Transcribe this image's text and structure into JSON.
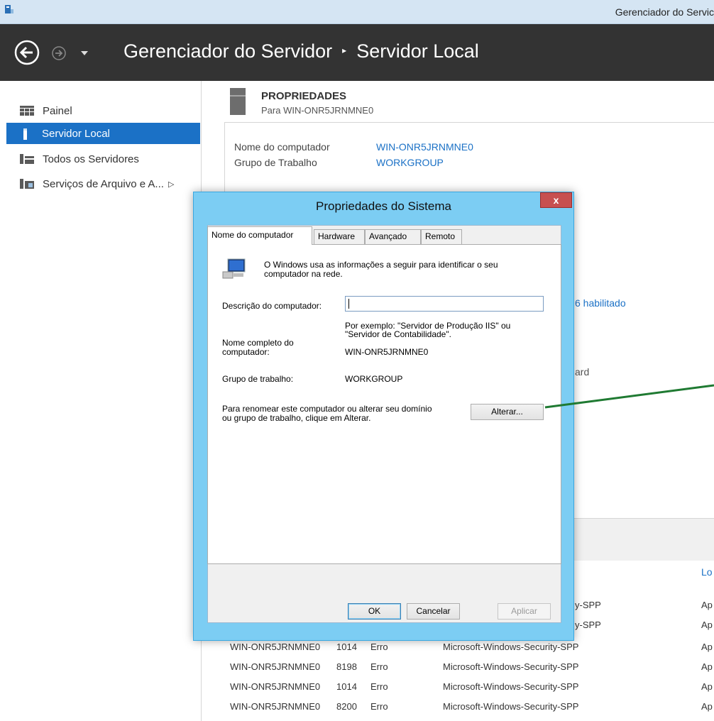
{
  "window": {
    "title": "Gerenciador do Servic"
  },
  "header": {
    "crumb_root": "Gerenciador do Servidor",
    "crumb_sep": "▸",
    "crumb_current": "Servidor Local"
  },
  "sidebar": {
    "items": [
      {
        "label": "Painel",
        "icon": "dashboard-icon"
      },
      {
        "label": "Servidor Local",
        "icon": "server-icon",
        "active": true
      },
      {
        "label": "Todos os Servidores",
        "icon": "servers-icon"
      },
      {
        "label": "Serviços de Arquivo e A...",
        "icon": "file-services-icon",
        "expand": "▷"
      }
    ]
  },
  "properties": {
    "title": "PROPRIEDADES",
    "subtitle": "Para WIN-ONR5JRNMNE0",
    "rows": [
      {
        "label": "Nome do computador",
        "value": "WIN-ONR5JRNMNE0"
      },
      {
        "label": "Grupo de Trabalho",
        "value": "WORKGROUP"
      }
    ],
    "peek_ipv6": "6 habilitado",
    "peek_ard": "ard"
  },
  "events": {
    "col_header": "Lo",
    "rows": [
      {
        "server": "",
        "id": "",
        "level": "",
        "source": "y-SPP",
        "log": "Ap"
      },
      {
        "server": "",
        "id": "",
        "level": "",
        "source": "y-SPP",
        "log": "Ap"
      },
      {
        "server": "WIN-ONR5JRNMNE0",
        "id": "1014",
        "level": "Erro",
        "source": "Microsoft-Windows-Security-SPP",
        "log": "Ap"
      },
      {
        "server": "WIN-ONR5JRNMNE0",
        "id": "8198",
        "level": "Erro",
        "source": "Microsoft-Windows-Security-SPP",
        "log": "Ap"
      },
      {
        "server": "WIN-ONR5JRNMNE0",
        "id": "1014",
        "level": "Erro",
        "source": "Microsoft-Windows-Security-SPP",
        "log": "Ap"
      },
      {
        "server": "WIN-ONR5JRNMNE0",
        "id": "8200",
        "level": "Erro",
        "source": "Microsoft-Windows-Security-SPP",
        "log": "Ap"
      }
    ]
  },
  "dialog": {
    "title": "Propriedades do Sistema",
    "close": "x",
    "tabs": [
      "Nome do computador",
      "Hardware",
      "Avançado",
      "Remoto"
    ],
    "intro_line1": "O Windows usa as informações a seguir para identificar o seu",
    "intro_line2": "computador na rede.",
    "desc_label": "Descrição do computador:",
    "desc_value": "",
    "example_line1": "Por exemplo: \"Servidor de Produção IIS\" ou",
    "example_line2": "\"Servidor de Contabilidade\".",
    "fullname_label_1": "Nome completo do",
    "fullname_label_2": "computador:",
    "fullname_value": "WIN-ONR5JRNMNE0",
    "workgroup_label": "Grupo de trabalho:",
    "workgroup_value": "WORKGROUP",
    "rename_line1": "Para renomear este computador ou alterar seu domínio",
    "rename_line2": "ou grupo de trabalho, clique em Alterar.",
    "change_button": "Alterar...",
    "ok_button": "OK",
    "cancel_button": "Cancelar",
    "apply_button": "Aplicar"
  },
  "annotation_color": "#1f7a32"
}
